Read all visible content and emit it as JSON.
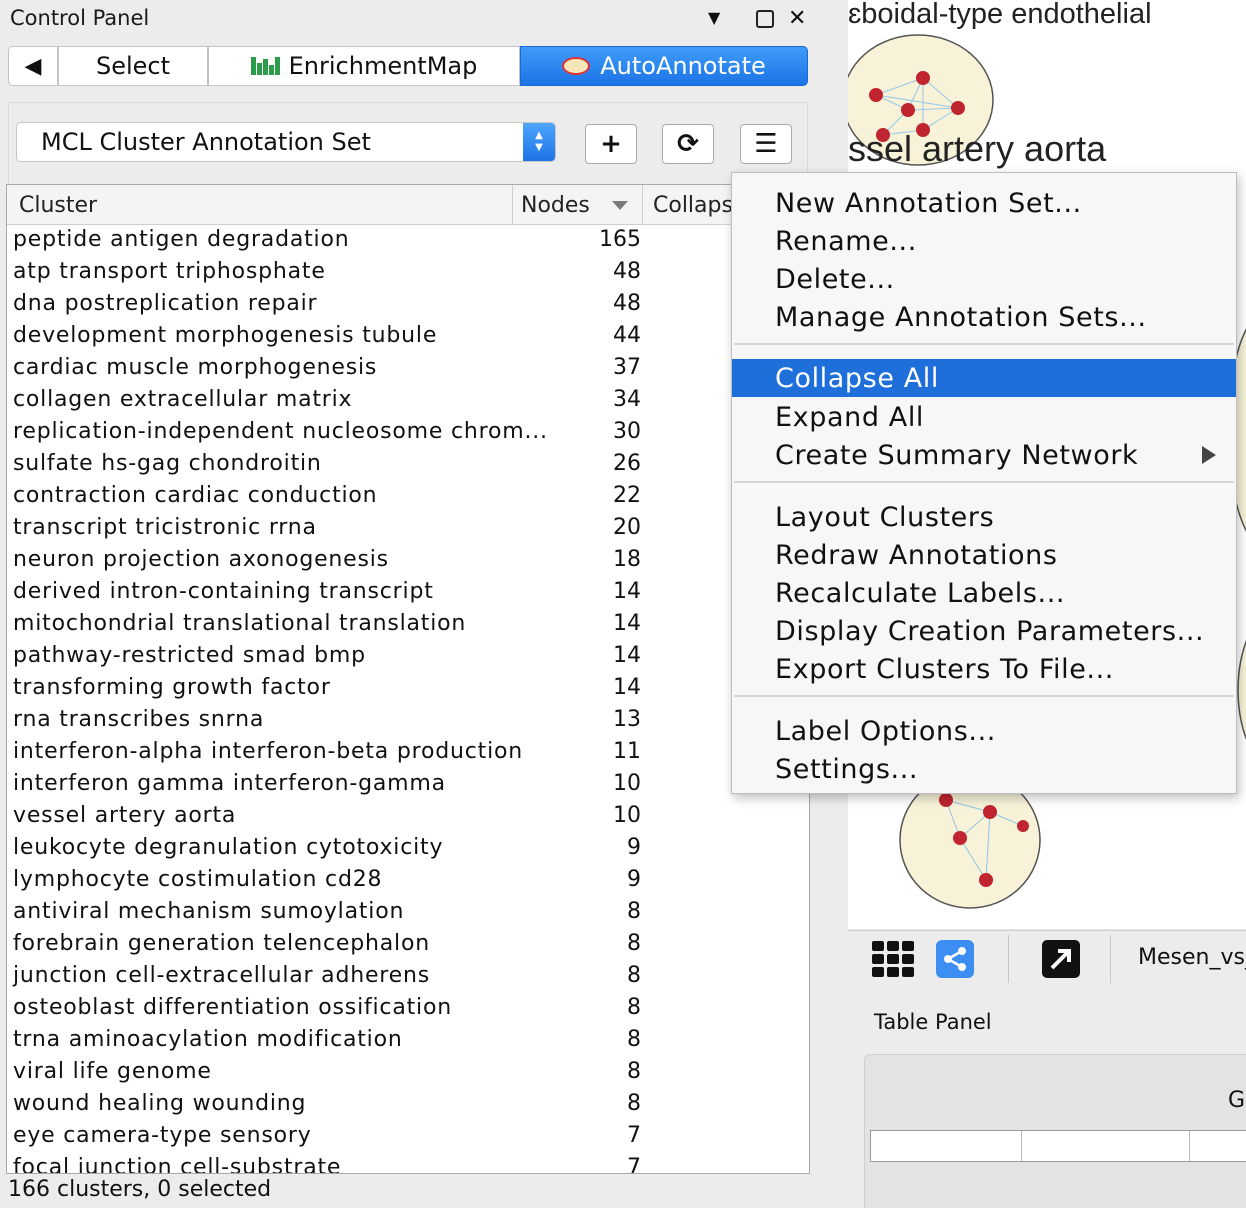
{
  "control_panel": {
    "title": "Control Panel",
    "tabs": {
      "back": "◀",
      "select": "Select",
      "enrichmentmap": "EnrichmentMap",
      "autoannotate": "AutoAnnotate"
    },
    "annotation_set": "MCL Cluster Annotation Set",
    "toolbar": {
      "add": "+",
      "refresh": "⟳",
      "menu": "☰"
    },
    "table": {
      "headers": {
        "cluster": "Cluster",
        "nodes": "Nodes",
        "collapsed": "Collaps"
      },
      "rows": [
        {
          "cluster": "peptide antigen degradation",
          "nodes": "165"
        },
        {
          "cluster": "atp transport triphosphate",
          "nodes": "48"
        },
        {
          "cluster": "dna postreplication repair",
          "nodes": "48"
        },
        {
          "cluster": "development morphogenesis tubule",
          "nodes": "44"
        },
        {
          "cluster": "cardiac muscle morphogenesis",
          "nodes": "37"
        },
        {
          "cluster": "collagen extracellular matrix",
          "nodes": "34"
        },
        {
          "cluster": "replication-independent nucleosome chrom...",
          "nodes": "30"
        },
        {
          "cluster": "sulfate hs-gag chondroitin",
          "nodes": "26"
        },
        {
          "cluster": "contraction cardiac conduction",
          "nodes": "22"
        },
        {
          "cluster": "transcript tricistronic rrna",
          "nodes": "20"
        },
        {
          "cluster": "neuron projection axonogenesis",
          "nodes": "18"
        },
        {
          "cluster": "derived intron-containing transcript",
          "nodes": "14"
        },
        {
          "cluster": "mitochondrial translational translation",
          "nodes": "14"
        },
        {
          "cluster": "pathway-restricted smad bmp",
          "nodes": "14"
        },
        {
          "cluster": "transforming growth factor",
          "nodes": "14"
        },
        {
          "cluster": "rna transcribes snrna",
          "nodes": "13"
        },
        {
          "cluster": "interferon-alpha interferon-beta production",
          "nodes": "11"
        },
        {
          "cluster": "interferon gamma interferon-gamma",
          "nodes": "10"
        },
        {
          "cluster": "vessel artery aorta",
          "nodes": "10"
        },
        {
          "cluster": "leukocyte degranulation cytotoxicity",
          "nodes": "9"
        },
        {
          "cluster": "lymphocyte costimulation cd28",
          "nodes": "9"
        },
        {
          "cluster": "antiviral mechanism sumoylation",
          "nodes": "8"
        },
        {
          "cluster": "forebrain generation telencephalon",
          "nodes": "8"
        },
        {
          "cluster": "junction cell-extracellular adherens",
          "nodes": "8"
        },
        {
          "cluster": "osteoblast differentiation ossification",
          "nodes": "8"
        },
        {
          "cluster": "trna aminoacylation modification",
          "nodes": "8"
        },
        {
          "cluster": "viral life genome",
          "nodes": "8"
        },
        {
          "cluster": "wound healing wounding",
          "nodes": "8"
        },
        {
          "cluster": "eye camera-type sensory",
          "nodes": "7"
        },
        {
          "cluster": "focal junction cell-substrate",
          "nodes": "7"
        }
      ]
    },
    "status": "166 clusters, 0 selected"
  },
  "network_view": {
    "labels": {
      "top": "ɛboidal-type endothelial",
      "vessel": "ssel artery aorta"
    },
    "network_name": "Mesen_vs_"
  },
  "table_panel": {
    "title": "Table Panel",
    "partial_label": "G"
  },
  "menu": {
    "group1": [
      "New Annotation Set...",
      "Rename...",
      "Delete...",
      "Manage Annotation Sets..."
    ],
    "group2": [
      "Collapse All",
      "Expand All",
      "Create Summary Network"
    ],
    "group3": [
      "Layout Clusters",
      "Redraw Annotations",
      "Recalculate Labels...",
      "Display Creation Parameters...",
      "Export Clusters To File..."
    ],
    "group4": [
      "Label Options...",
      "Settings..."
    ],
    "highlighted": "Collapse All"
  },
  "colors": {
    "accent": "#1f6fdb",
    "node": "#c0252f",
    "cluster_fill": "#f7f2d8"
  },
  "icons": [
    "dropdown-arrow-icon",
    "maximize-icon",
    "close-icon",
    "enrichmentmap-logo-icon",
    "autoannotate-logo-icon",
    "grid-view-icon",
    "share-network-icon",
    "external-open-icon",
    "submenu-arrow-icon"
  ]
}
